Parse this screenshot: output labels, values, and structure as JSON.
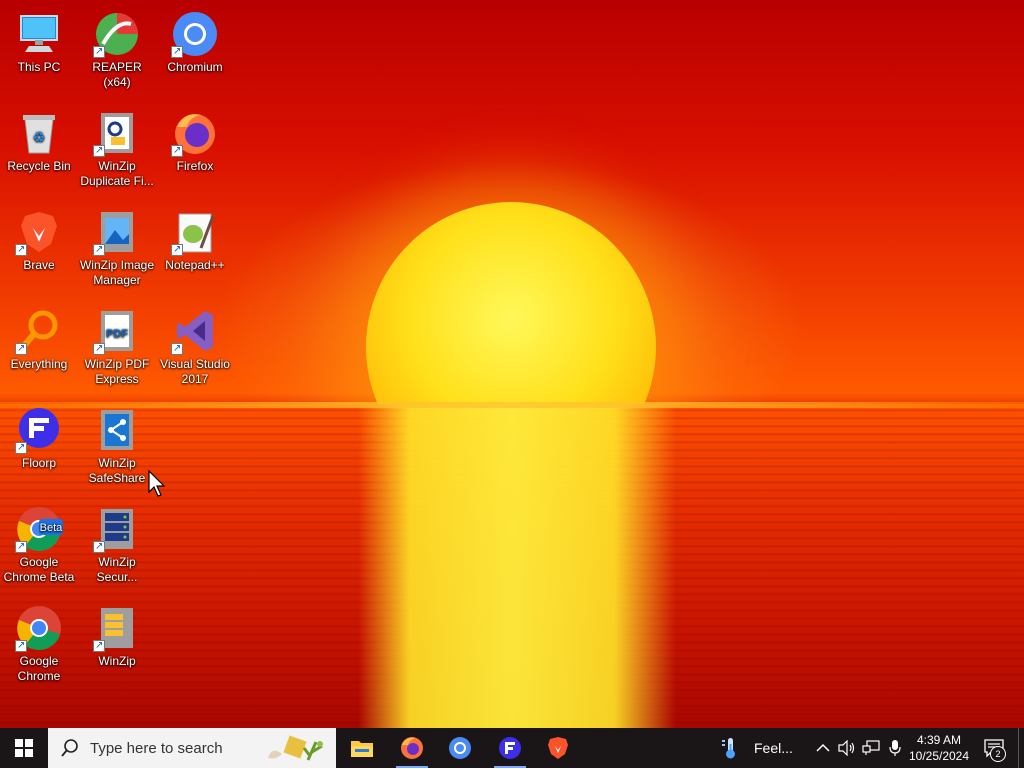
{
  "desktop": {
    "icons": [
      {
        "label": "This PC",
        "icon": "this-pc-icon"
      },
      {
        "label": "REAPER (x64)",
        "icon": "reaper-icon"
      },
      {
        "label": "Chromium",
        "icon": "chromium-icon"
      },
      {
        "label": "Recycle Bin",
        "icon": "recycle-bin-icon"
      },
      {
        "label": "WinZip Duplicate Fi...",
        "icon": "winzip-duplicate-icon"
      },
      {
        "label": "Firefox",
        "icon": "firefox-icon"
      },
      {
        "label": "Brave",
        "icon": "brave-icon"
      },
      {
        "label": "WinZip Image Manager",
        "icon": "winzip-image-icon"
      },
      {
        "label": "Notepad++",
        "icon": "notepadpp-icon"
      },
      {
        "label": "Everything",
        "icon": "everything-icon"
      },
      {
        "label": "WinZip PDF Express",
        "icon": "winzip-pdf-icon"
      },
      {
        "label": "Visual Studio 2017",
        "icon": "visual-studio-icon"
      },
      {
        "label": "Floorp",
        "icon": "floorp-icon"
      },
      {
        "label": "WinZip SafeShare",
        "icon": "winzip-safeshare-icon"
      },
      {
        "label": "Google Chrome Beta",
        "icon": "chrome-beta-icon"
      },
      {
        "label": "WinZip Secur...",
        "icon": "winzip-secure-icon"
      },
      {
        "label": "Google Chrome",
        "icon": "chrome-icon"
      },
      {
        "label": "WinZip",
        "icon": "winzip-icon"
      }
    ]
  },
  "taskbar": {
    "search_placeholder": "Type here to search",
    "weather_label": "Feel...",
    "time": "4:39 AM",
    "date": "10/25/2024",
    "notification_count": "2",
    "pinned": [
      "file-explorer-icon",
      "firefox-icon",
      "chromium-icon",
      "floorp-icon",
      "brave-icon"
    ]
  },
  "colors": {
    "taskbar": "#1a1516",
    "sky": "#d80f00",
    "sun": "#ffe01a"
  }
}
